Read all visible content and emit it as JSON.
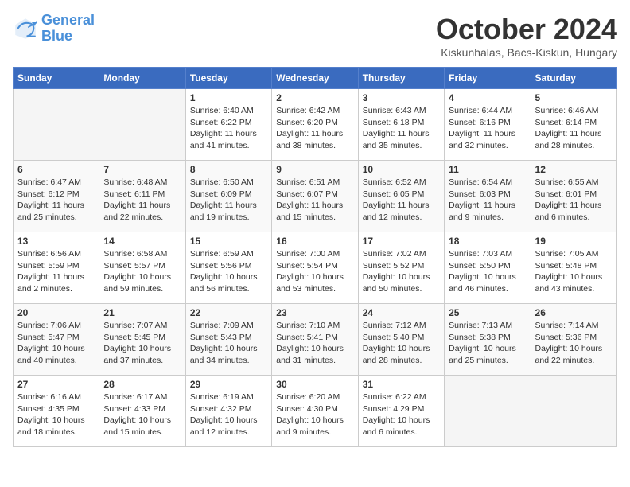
{
  "header": {
    "logo_line1": "General",
    "logo_line2": "Blue",
    "month": "October 2024",
    "location": "Kiskunhalas, Bacs-Kiskun, Hungary"
  },
  "days_of_week": [
    "Sunday",
    "Monday",
    "Tuesday",
    "Wednesday",
    "Thursday",
    "Friday",
    "Saturday"
  ],
  "weeks": [
    [
      {
        "day": "",
        "info": ""
      },
      {
        "day": "",
        "info": ""
      },
      {
        "day": "1",
        "info": "Sunrise: 6:40 AM\nSunset: 6:22 PM\nDaylight: 11 hours and 41 minutes."
      },
      {
        "day": "2",
        "info": "Sunrise: 6:42 AM\nSunset: 6:20 PM\nDaylight: 11 hours and 38 minutes."
      },
      {
        "day": "3",
        "info": "Sunrise: 6:43 AM\nSunset: 6:18 PM\nDaylight: 11 hours and 35 minutes."
      },
      {
        "day": "4",
        "info": "Sunrise: 6:44 AM\nSunset: 6:16 PM\nDaylight: 11 hours and 32 minutes."
      },
      {
        "day": "5",
        "info": "Sunrise: 6:46 AM\nSunset: 6:14 PM\nDaylight: 11 hours and 28 minutes."
      }
    ],
    [
      {
        "day": "6",
        "info": "Sunrise: 6:47 AM\nSunset: 6:12 PM\nDaylight: 11 hours and 25 minutes."
      },
      {
        "day": "7",
        "info": "Sunrise: 6:48 AM\nSunset: 6:11 PM\nDaylight: 11 hours and 22 minutes."
      },
      {
        "day": "8",
        "info": "Sunrise: 6:50 AM\nSunset: 6:09 PM\nDaylight: 11 hours and 19 minutes."
      },
      {
        "day": "9",
        "info": "Sunrise: 6:51 AM\nSunset: 6:07 PM\nDaylight: 11 hours and 15 minutes."
      },
      {
        "day": "10",
        "info": "Sunrise: 6:52 AM\nSunset: 6:05 PM\nDaylight: 11 hours and 12 minutes."
      },
      {
        "day": "11",
        "info": "Sunrise: 6:54 AM\nSunset: 6:03 PM\nDaylight: 11 hours and 9 minutes."
      },
      {
        "day": "12",
        "info": "Sunrise: 6:55 AM\nSunset: 6:01 PM\nDaylight: 11 hours and 6 minutes."
      }
    ],
    [
      {
        "day": "13",
        "info": "Sunrise: 6:56 AM\nSunset: 5:59 PM\nDaylight: 11 hours and 2 minutes."
      },
      {
        "day": "14",
        "info": "Sunrise: 6:58 AM\nSunset: 5:57 PM\nDaylight: 10 hours and 59 minutes."
      },
      {
        "day": "15",
        "info": "Sunrise: 6:59 AM\nSunset: 5:56 PM\nDaylight: 10 hours and 56 minutes."
      },
      {
        "day": "16",
        "info": "Sunrise: 7:00 AM\nSunset: 5:54 PM\nDaylight: 10 hours and 53 minutes."
      },
      {
        "day": "17",
        "info": "Sunrise: 7:02 AM\nSunset: 5:52 PM\nDaylight: 10 hours and 50 minutes."
      },
      {
        "day": "18",
        "info": "Sunrise: 7:03 AM\nSunset: 5:50 PM\nDaylight: 10 hours and 46 minutes."
      },
      {
        "day": "19",
        "info": "Sunrise: 7:05 AM\nSunset: 5:48 PM\nDaylight: 10 hours and 43 minutes."
      }
    ],
    [
      {
        "day": "20",
        "info": "Sunrise: 7:06 AM\nSunset: 5:47 PM\nDaylight: 10 hours and 40 minutes."
      },
      {
        "day": "21",
        "info": "Sunrise: 7:07 AM\nSunset: 5:45 PM\nDaylight: 10 hours and 37 minutes."
      },
      {
        "day": "22",
        "info": "Sunrise: 7:09 AM\nSunset: 5:43 PM\nDaylight: 10 hours and 34 minutes."
      },
      {
        "day": "23",
        "info": "Sunrise: 7:10 AM\nSunset: 5:41 PM\nDaylight: 10 hours and 31 minutes."
      },
      {
        "day": "24",
        "info": "Sunrise: 7:12 AM\nSunset: 5:40 PM\nDaylight: 10 hours and 28 minutes."
      },
      {
        "day": "25",
        "info": "Sunrise: 7:13 AM\nSunset: 5:38 PM\nDaylight: 10 hours and 25 minutes."
      },
      {
        "day": "26",
        "info": "Sunrise: 7:14 AM\nSunset: 5:36 PM\nDaylight: 10 hours and 22 minutes."
      }
    ],
    [
      {
        "day": "27",
        "info": "Sunrise: 6:16 AM\nSunset: 4:35 PM\nDaylight: 10 hours and 18 minutes."
      },
      {
        "day": "28",
        "info": "Sunrise: 6:17 AM\nSunset: 4:33 PM\nDaylight: 10 hours and 15 minutes."
      },
      {
        "day": "29",
        "info": "Sunrise: 6:19 AM\nSunset: 4:32 PM\nDaylight: 10 hours and 12 minutes."
      },
      {
        "day": "30",
        "info": "Sunrise: 6:20 AM\nSunset: 4:30 PM\nDaylight: 10 hours and 9 minutes."
      },
      {
        "day": "31",
        "info": "Sunrise: 6:22 AM\nSunset: 4:29 PM\nDaylight: 10 hours and 6 minutes."
      },
      {
        "day": "",
        "info": ""
      },
      {
        "day": "",
        "info": ""
      }
    ]
  ]
}
